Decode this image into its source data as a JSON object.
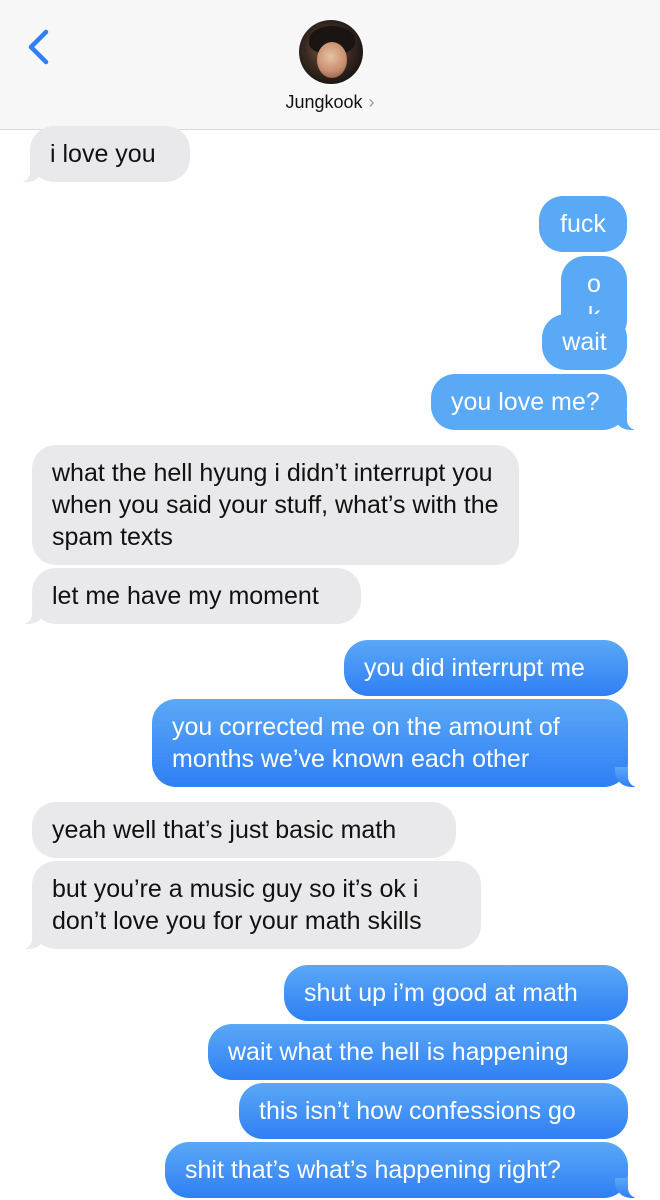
{
  "header": {
    "contact_name": "Jungkook",
    "chevron": "›",
    "back_icon": "chevron-left-icon"
  },
  "colors": {
    "incoming": "#e9e9eb",
    "outgoing": "#3b8ef5",
    "accent": "#2f7ff5"
  },
  "messages": [
    {
      "side": "in",
      "text": "i love you"
    },
    {
      "side": "out",
      "text": "fuck"
    },
    {
      "side": "out",
      "text": "ok"
    },
    {
      "side": "out",
      "text": "wait"
    },
    {
      "side": "out",
      "text": "you love me?"
    },
    {
      "side": "in",
      "text": "what the hell hyung i didn’t interrupt you when you said your stuff, what’s with the spam texts"
    },
    {
      "side": "in",
      "text": "let me have my moment"
    },
    {
      "side": "out",
      "text": "you did interrupt me"
    },
    {
      "side": "out",
      "text": "you corrected me on the amount of months we’ve known each other"
    },
    {
      "side": "in",
      "text": "yeah well that’s just basic math"
    },
    {
      "side": "in",
      "text": "but you’re a music guy so it’s ok i don’t love you for your math skills"
    },
    {
      "side": "out",
      "text": "shut up i’m good at math"
    },
    {
      "side": "out",
      "text": "wait what the hell is happening"
    },
    {
      "side": "out",
      "text": "this isn’t how confessions go"
    },
    {
      "side": "out",
      "text": "shit that’s what’s happening right?"
    }
  ]
}
